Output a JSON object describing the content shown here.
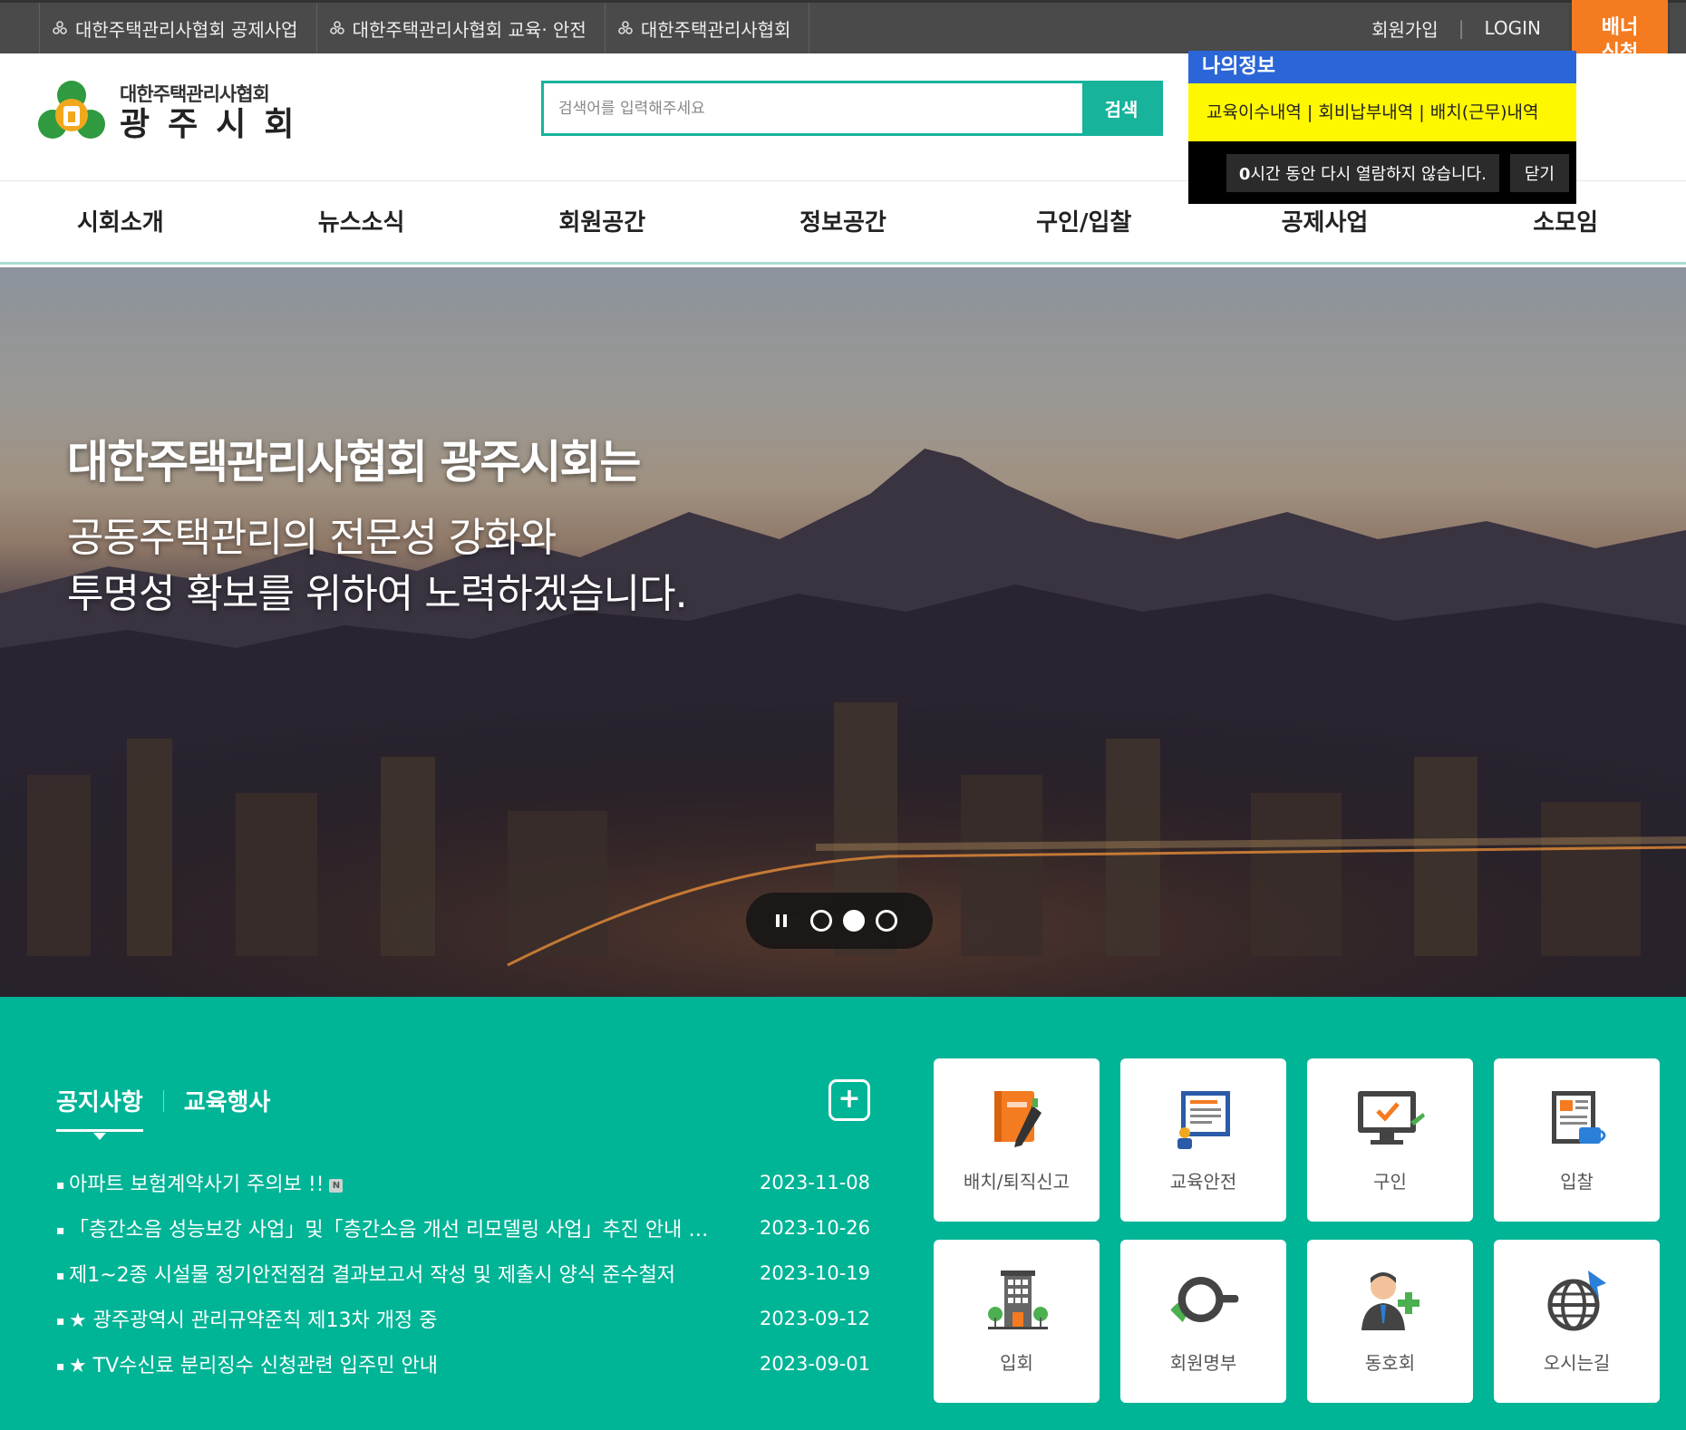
{
  "topbar": {
    "links": [
      "대한주택관리사협회 공제사업",
      "대한주택관리사협회 교육· 안전",
      "대한주택관리사협회"
    ],
    "join": "회원가입",
    "login": "LOGIN",
    "banner_line1": "배너",
    "banner_line2": "신청"
  },
  "header": {
    "logo_sub": "대한주택관리사협회",
    "logo_main": "광주시회",
    "search_placeholder": "검색어를 입력해주세요",
    "search_button": "검색"
  },
  "nav": [
    "시회소개",
    "뉴스소식",
    "회원공간",
    "정보공간",
    "구인/입찰",
    "공제사업",
    "소모임"
  ],
  "popup": {
    "title": "나의정보",
    "link1": "교육이수내역",
    "link2": "회비납부내역",
    "link3": "배치(근무)내역",
    "separator": " | ",
    "dont_show_hours": "0",
    "dont_show_text": "시간 동안 다시 열람하지 않습니다.",
    "close": "닫기"
  },
  "hero": {
    "line1": "대한주택관리사협회 광주시회는",
    "line2": "공동주택관리의 전문성 강화와",
    "line3": "투명성 확보를 위하여 노력하겠습니다.",
    "active_slide": 2,
    "slide_count": 3
  },
  "board": {
    "tab_notice": "공지사항",
    "tab_edu": "교육행사",
    "more": "+",
    "items": [
      {
        "title": "아파트 보험계약사기 주의보 !!",
        "date": "2023-11-08",
        "badge": "N"
      },
      {
        "title": "「층간소음 성능보강 사업」및「층간소음 개선 리모델링 사업」추진 안내 및 협조 요청",
        "date": "2023-10-26"
      },
      {
        "title": "제1~2종 시설물 정기안전점검 결과보고서 작성 및 제출시 양식 준수철저",
        "date": "2023-10-19"
      },
      {
        "title": "★ 광주광역시 관리규약준칙 제13차 개정 중",
        "date": "2023-09-12"
      },
      {
        "title": "★ TV수신료 분리징수 신청관련 입주민 안내",
        "date": "2023-09-01"
      }
    ]
  },
  "quick": [
    {
      "label": "배치/퇴직신고",
      "icon": "notebook-pen-icon"
    },
    {
      "label": "교육안전",
      "icon": "presentation-board-icon"
    },
    {
      "label": "구인",
      "icon": "monitor-check-icon"
    },
    {
      "label": "입찰",
      "icon": "document-coffee-icon"
    },
    {
      "label": "입회",
      "icon": "building-icon"
    },
    {
      "label": "회원명부",
      "icon": "frying-pan-icon"
    },
    {
      "label": "동호회",
      "icon": "person-add-icon"
    },
    {
      "label": "오시는길",
      "icon": "globe-pin-icon"
    }
  ],
  "colors": {
    "accent": "#00b496",
    "popup_blue": "#2b66d8",
    "popup_yellow": "#fff700",
    "banner_orange": "#f47b20"
  }
}
